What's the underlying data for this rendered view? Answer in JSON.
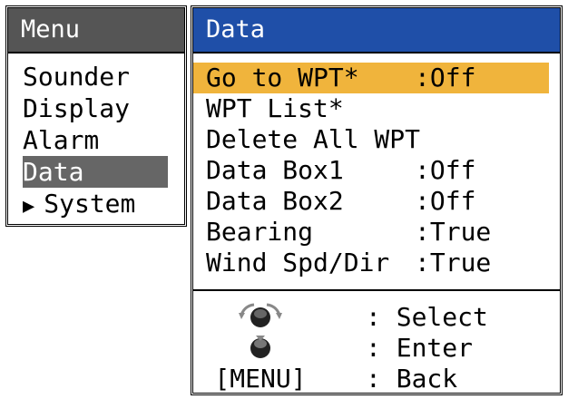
{
  "menu": {
    "title": "Menu",
    "items": [
      {
        "label": "Sounder",
        "selected": false
      },
      {
        "label": "Display",
        "selected": false
      },
      {
        "label": "Alarm",
        "selected": false
      },
      {
        "label": "Data",
        "selected": true
      },
      {
        "label": "System",
        "selected": false,
        "has_arrow": true
      }
    ]
  },
  "data_panel": {
    "title": "Data",
    "items": [
      {
        "label": "Go to WPT*",
        "value": ":Off",
        "selected": true
      },
      {
        "label": "WPT List*",
        "value": "",
        "selected": false
      },
      {
        "label": "Delete All WPT",
        "value": "",
        "selected": false
      },
      {
        "label": "Data Box1",
        "value": ":Off",
        "selected": false
      },
      {
        "label": "Data Box2",
        "value": ":Off",
        "selected": false
      },
      {
        "label": "Bearing",
        "value": ":True",
        "selected": false
      },
      {
        "label": "Wind Spd/Dir",
        "value": ":True",
        "selected": false
      }
    ]
  },
  "help": {
    "select_desc": ": Select",
    "enter_desc": ": Enter",
    "back_key": "[MENU]",
    "back_desc": ": Back"
  },
  "colors": {
    "menu_title_bg": "#555555",
    "data_title_bg": "#1f4fa8",
    "selected_item_bg": "#f0b43c",
    "selected_menu_bg": "#666666"
  },
  "icons": {
    "arrow": "arrow-right-icon",
    "rotate_knob": "rotary-knob-icon",
    "push_knob": "push-knob-icon"
  }
}
